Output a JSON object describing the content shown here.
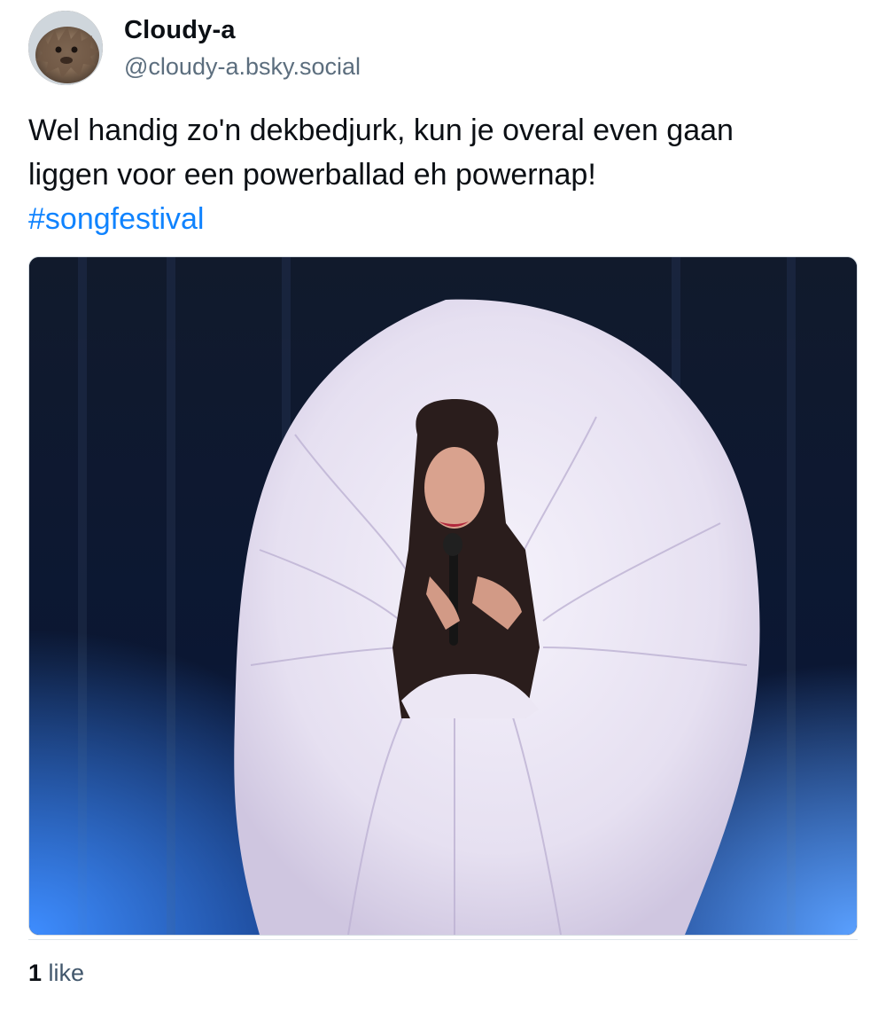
{
  "author": {
    "display_name": "Cloudy-a",
    "handle": "@cloudy-a.bsky.social",
    "avatar_icon": "furry-creature-avatar"
  },
  "post": {
    "text_line_1": "Wel handig zo'n dekbedjurk, kun je overal even gaan",
    "text_line_2": "liggen voor een powerballad eh powernap!",
    "hashtag": "#songfestival"
  },
  "media": {
    "kind": "photo"
  },
  "stats": {
    "like_count": "1",
    "like_label": "like"
  },
  "colors": {
    "accent": "#1083fe",
    "muted": "#5c6e7e",
    "text": "#0b0f14"
  }
}
